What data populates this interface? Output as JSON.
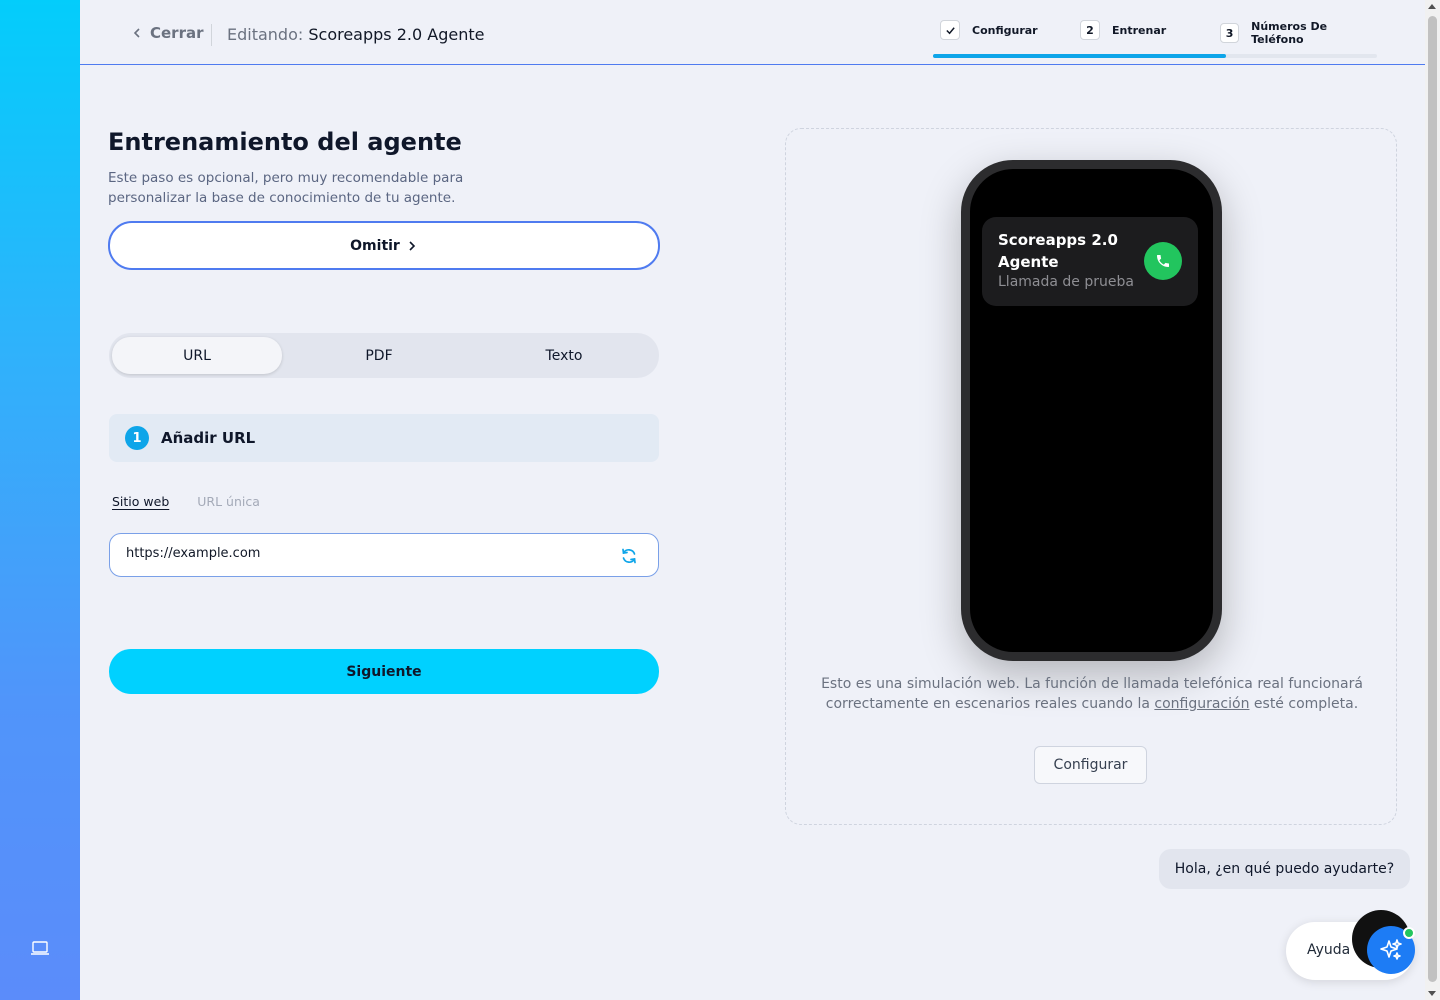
{
  "header": {
    "back_label": "Cerrar",
    "editing_prefix": "Editando:",
    "agent_name": "Scoreapps 2.0 Agente"
  },
  "steps": {
    "items": [
      {
        "number": "",
        "label": "Configurar",
        "state": "done"
      },
      {
        "number": "2",
        "label": "Entrenar",
        "state": "current"
      },
      {
        "number": "3",
        "label": "Números De Teléfono",
        "state": "pending"
      }
    ],
    "progress_percent": 66
  },
  "training": {
    "title": "Entrenamiento del agente",
    "subtitle": "Este paso es opcional, pero muy recomendable para personalizar la base de conocimiento de tu agente.",
    "skip_label": "Omitir",
    "source_tabs": [
      "URL",
      "PDF",
      "Texto"
    ],
    "active_tab": "URL",
    "section_number": "1",
    "section_label": "Añadir URL",
    "url_modes": [
      "Sitio web",
      "URL única"
    ],
    "active_url_mode": "Sitio web",
    "url_value": "https://example.com",
    "next_label": "Siguiente"
  },
  "preview": {
    "call_name": "Scoreapps 2.0 Agente",
    "call_subtitle": "Llamada de prueba",
    "disclaimer_before": "Esto es una simulación web. La función de llamada telefónica real funcionará correctamente en escenarios reales cuando la",
    "disclaimer_link": "configuración",
    "disclaimer_after": "esté completa.",
    "configure_label": "Configurar"
  },
  "help": {
    "chat_message": "Hola, ¿en qué puedo ayudarte?",
    "help_label": "Ayuda"
  },
  "colors": {
    "accent": "#0ea5e9",
    "primary_button": "#00d1ff",
    "call_green": "#22c55e",
    "ai_blue": "#1d7cf5"
  },
  "icons": {
    "back": "chevron-left-icon",
    "check": "check-icon",
    "skip": "chevron-right-icon",
    "refresh": "refresh-icon",
    "phone": "phone-icon",
    "ai": "sparkle-icon",
    "sidebar": "laptop-icon"
  }
}
